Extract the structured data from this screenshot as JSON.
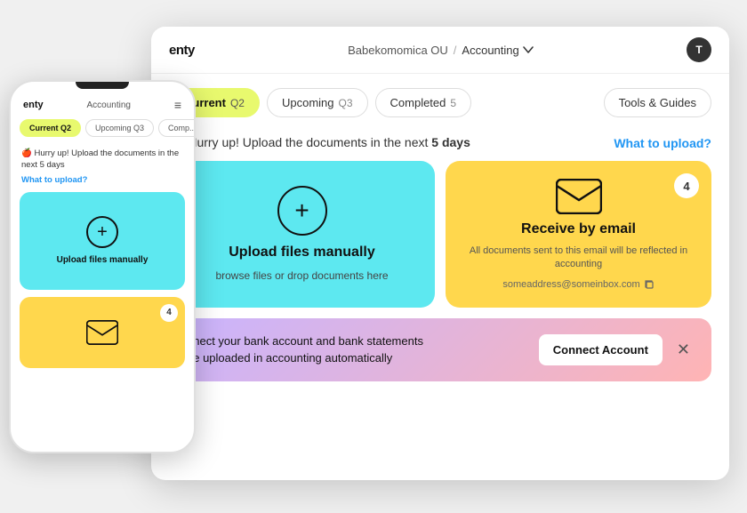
{
  "app": {
    "logo": "enty",
    "breadcrumb": {
      "company": "Babekomomica OU",
      "separator": "/",
      "section": "Accounting"
    },
    "user_avatar_label": "T"
  },
  "tabs": {
    "current": {
      "label": "Current",
      "period": "Q2",
      "active": true
    },
    "upcoming": {
      "label": "Upcoming",
      "period": "Q3"
    },
    "completed": {
      "label": "Completed",
      "count": "5"
    },
    "tools": {
      "label": "Tools & Guides"
    }
  },
  "urgency": {
    "icon": "🍎",
    "text": "Hurry up! Upload the documents in the next ",
    "bold": "5 days",
    "link": "What to upload?"
  },
  "card_upload": {
    "title": "Upload files manually",
    "subtitle": "browse files or drop documents here"
  },
  "card_email": {
    "title": "Receive by email",
    "subtitle": "All documents sent to this email will be reflected in accounting",
    "email": "someaddress@someinbox.com",
    "badge": "4"
  },
  "connect_bank": {
    "text_line1": "nnect your bank account and bank statements",
    "text_line2": "be uploaded in accounting automatically",
    "button_label": "Connect Account"
  },
  "mobile": {
    "logo": "enty",
    "breadcrumb": "Accounting",
    "tabs": {
      "current": "Current Q2",
      "upcoming": "Upcoming Q3",
      "completed": "Comp..."
    },
    "urgency_text": "Hurry up! Upload the documents in the next 5 days",
    "what_to_upload": "What to upload?",
    "upload_card_title": "Upload files manually",
    "email_badge": "4"
  },
  "colors": {
    "cyan": "#5de8f0",
    "yellow": "#ffd74d",
    "lime": "#e8f96e",
    "purple_pink": "linear-gradient(135deg,#c8b4ff,#ffb4b4)",
    "blue_link": "#2196f3"
  }
}
